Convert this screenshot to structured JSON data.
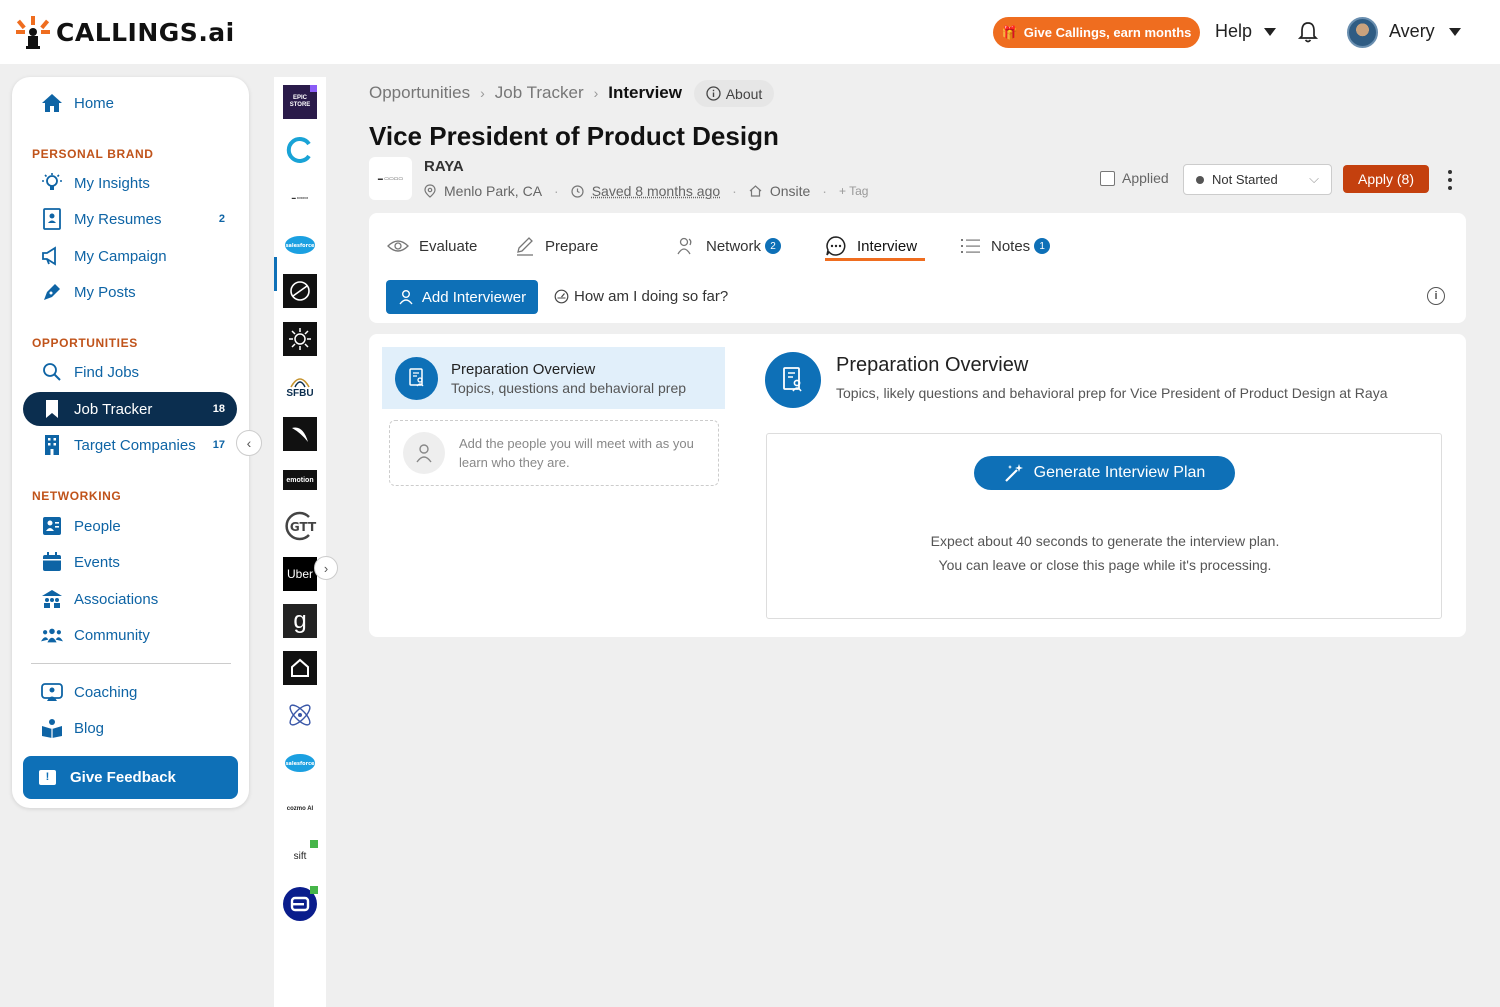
{
  "brand": {
    "name": "CALLINGS",
    "suffix": ".ai"
  },
  "topbar": {
    "promo_label": "Give Callings, earn months",
    "help_label": "Help",
    "user_name": "Avery"
  },
  "sidebar": {
    "home": "Home",
    "sections": {
      "personal_brand": "PERSONAL BRAND",
      "opportunities": "OPPORTUNITIES",
      "networking": "NETWORKING"
    },
    "items": {
      "insights": "My Insights",
      "resumes": "My Resumes",
      "resumes_count": "2",
      "campaign": "My Campaign",
      "posts": "My Posts",
      "find_jobs": "Find Jobs",
      "job_tracker": "Job Tracker",
      "job_tracker_count": "18",
      "target_companies": "Target Companies",
      "target_companies_count": "17",
      "people": "People",
      "events": "Events",
      "associations": "Associations",
      "community": "Community",
      "coaching": "Coaching",
      "blog": "Blog"
    },
    "feedback": "Give Feedback"
  },
  "rail": {
    "companies": [
      "EPIC STORE",
      "SFBU",
      "emotion",
      "GTT",
      "Uber",
      "g",
      "cozmo AI",
      "sift",
      "salesforce"
    ]
  },
  "breadcrumb": {
    "opportunities": "Opportunities",
    "job_tracker": "Job Tracker",
    "current": "Interview",
    "about": "About"
  },
  "job": {
    "title": "Vice President of Product Design",
    "company": "RAYA",
    "location": "Menlo Park, CA",
    "saved": "Saved 8 months ago",
    "work_mode": "Onsite",
    "tag_label": "Tag",
    "applied_label": "Applied",
    "status": "Not Started",
    "apply_label": "Apply (8)"
  },
  "tabs": [
    {
      "label": "Evaluate"
    },
    {
      "label": "Prepare"
    },
    {
      "label": "Network",
      "badge": "2"
    },
    {
      "label": "Interview"
    },
    {
      "label": "Notes",
      "badge": "1"
    }
  ],
  "actions": {
    "add_interviewer": "Add Interviewer",
    "how_doing": "How am I doing so far?"
  },
  "prep": {
    "item_title": "Preparation Overview",
    "item_sub": "Topics, questions and behavioral prep",
    "people_hint": "Add the people you will meet with as you learn who they are.",
    "overview_title": "Preparation Overview",
    "overview_sub": "Topics, likely questions and behavioral prep for Vice President of Product Design at Raya",
    "generate_label": "Generate Interview Plan",
    "note_line1": "Expect about 40 seconds to generate the interview plan.",
    "note_line2": "You can leave or close this page while it's processing."
  },
  "colors": {
    "accent": "#0e70b7",
    "orange": "#ef6d1f",
    "apply": "#c4400e",
    "nav_active": "#0b2e4f"
  }
}
